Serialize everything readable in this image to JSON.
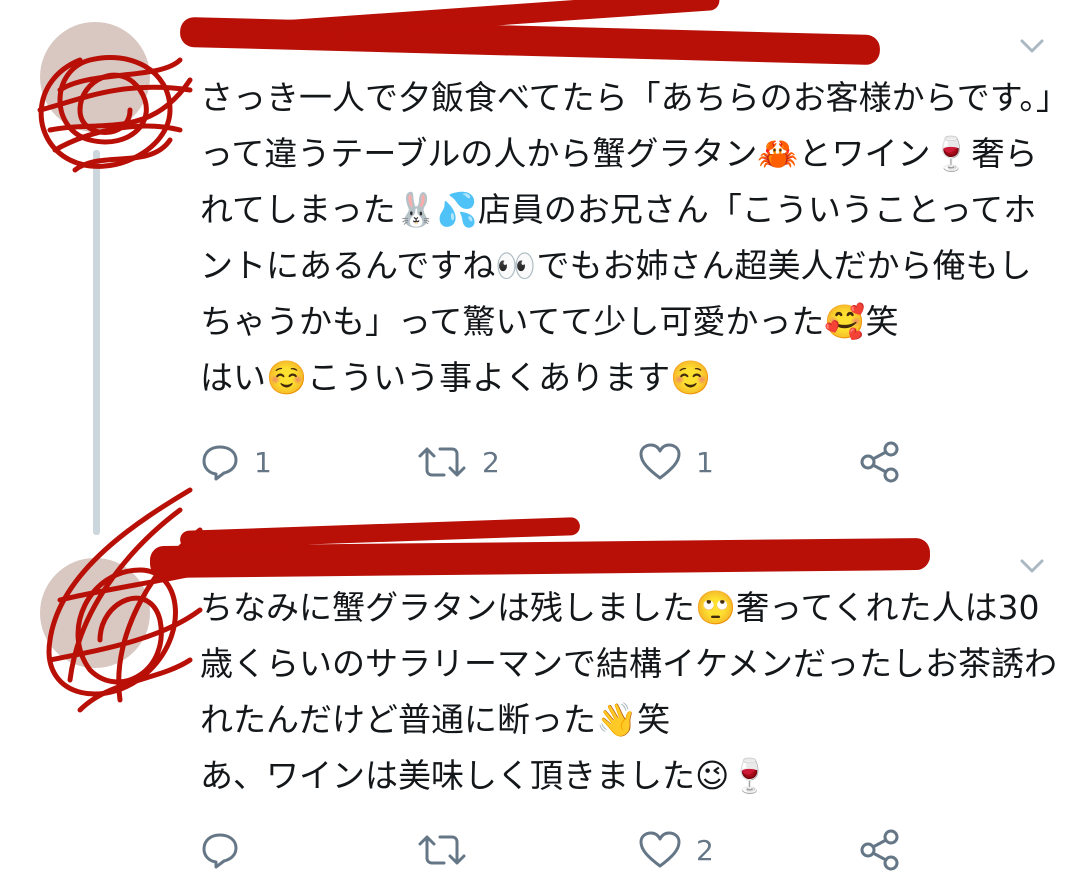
{
  "tweets": [
    {
      "text": "さっき一人で夕飯食べてたら「あちらのお客様からです。」って違うテーブルの人から蟹グラタン🦀とワイン🍷奢られてしまった🐰💦店員のお兄さん「こういうことってホントにあるんですね👀でもお姉さん超美人だから俺もしちゃうかも」って驚いてて少し可愛かった🥰笑\nはい☺️こういう事よくあります☺️",
      "actions": {
        "reply_icon": "reply-icon",
        "reply_count": "1",
        "retweet_icon": "retweet-icon",
        "retweet_count": "2",
        "like_icon": "heart-icon",
        "like_count": "1",
        "share_icon": "share-icon"
      }
    },
    {
      "text": "ちなみに蟹グラタンは残しました🙄奢ってくれた人は30歳くらいのサラリーマンで結構イケメンだったしお茶誘われたんだけど普通に断った👋笑\nあ、ワインは美味しく頂きました😉🍷",
      "actions": {
        "reply_icon": "reply-icon",
        "reply_count": "",
        "retweet_icon": "retweet-icon",
        "retweet_count": "",
        "like_icon": "heart-icon",
        "like_count": "2",
        "share_icon": "share-icon"
      }
    }
  ],
  "colors": {
    "redaction": "#b80f07",
    "icon_gray": "#657786",
    "thread_line": "#ccd6dd"
  }
}
